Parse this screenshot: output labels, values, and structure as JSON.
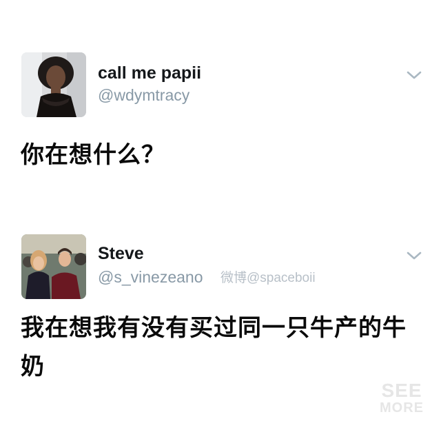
{
  "tweets": [
    {
      "display_name": "call me papii",
      "handle": "@wdymtracy",
      "text": "你在想什么？",
      "avatar_icon": "profile-photo-1",
      "menu_icon": "chevron-down-icon"
    },
    {
      "display_name": "Steve",
      "handle": "@s_vinezeano",
      "text": "我在想我有没有买过同一只牛产的牛奶",
      "avatar_icon": "profile-photo-2",
      "menu_icon": "chevron-down-icon"
    }
  ],
  "watermark": "微博@spaceboii",
  "see_more": {
    "line1": "SEE",
    "line2": "MORE"
  },
  "colors": {
    "name": "#14171a",
    "handle": "#8899a6",
    "chevron": "#aab8c2",
    "watermark": "#b8c0c8",
    "see_more": "#e6e6e6"
  }
}
